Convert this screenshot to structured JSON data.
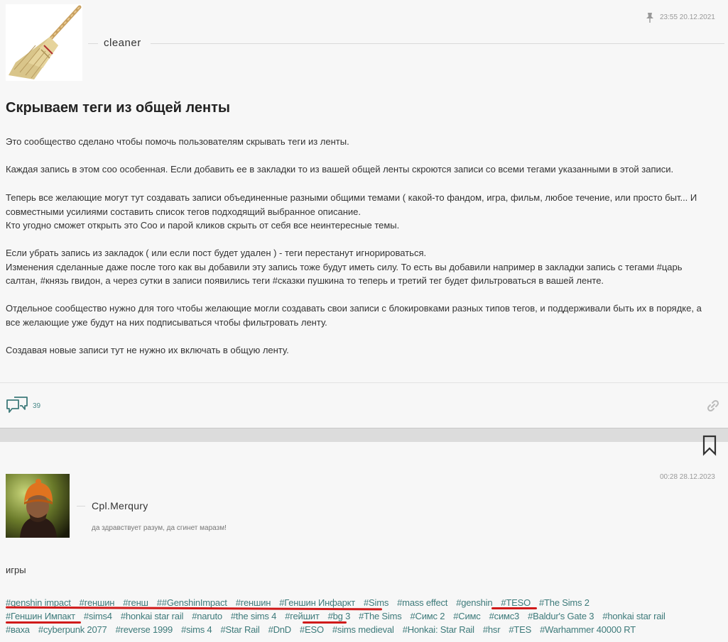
{
  "post1": {
    "author": "cleaner",
    "date": "23:55 20.12.2021",
    "title": "Скрываем теги из общей ленты",
    "paragraphs": [
      "Это сообщество сделано чтобы помочь пользователям скрывать теги из ленты.",
      "Каждая запись в этом соо особенная. Если добавить ее в закладки то из вашей общей ленты скроются записи со всеми тегами указанными в этой записи.",
      "Теперь все желающие могут тут создавать записи объединенные разными общими темами ( какой-то фандом, игра, фильм, любое течение, или просто быт... И",
      "совместными усилиями составить список тегов подходящий выбранное описание.",
      "Кто угодно сможет открыть это Соо и парой кликов скрыть от себя все неинтересные темы.",
      "Если убрать запись из закладок ( или если пост будет удален ) -  теги перестанут игнорироваться.",
      "Изменения сделанные даже после того как вы добавили эту запись тоже будут иметь силу. То есть вы добавили например в закладки запись с тегами #царь",
      "салтан, #князь гвидон, а через сутки в записи появились теги #сказки пушкина то теперь и третий тег будет фильтроваться в вашей ленте.",
      "Отдельное сообщество нужно для того чтобы желающие могли создавать свои записи с блокировками разных типов тегов, и поддерживали быть их в порядке, а",
      "все желающие уже будут на них подписываться чтобы фильтровать ленту.",
      "Создавая  новые записи тут не нужно их  включать в общую ленту."
    ],
    "comments_count": "39"
  },
  "post2": {
    "author": "Cpl.Merqury",
    "status": "да здравствует разум, да сгинет маразм!",
    "date": "00:28 28.12.2023",
    "text": "игры",
    "tag_rows": [
      [
        "#genshin impact",
        "#геншин",
        "#генш",
        "##GenshinImpact",
        "#геншин",
        "#Геншин Инфаркт",
        "#Sims",
        "#mass effect",
        "#genshin",
        "#TESO",
        "#The Sims 2"
      ],
      [
        "#Геншин Импакт",
        "#sims4",
        "#honkai star rail",
        "#naruto",
        "#the sims 4",
        "#гейшит",
        "#bg 3",
        "#The Sims",
        "#Симс 2",
        "#Симс",
        "#симс3",
        "#Baldur's Gate 3",
        "#honkai star rail"
      ],
      [
        "#ваха",
        "#cyberpunk 2077",
        "#reverse 1999",
        "#sims 4",
        "#Star Rail",
        "#DnD",
        "#ESO",
        "#sims medieval",
        "#Honkai: Star Rail",
        "#hsr",
        "#TES",
        "#Warhammer 40000 RT"
      ]
    ]
  },
  "colors": {
    "accent": "#3d7a7a",
    "underline": "#d01a1a",
    "background": "#f7f7f7"
  },
  "icons": {
    "pin": "pin-icon",
    "comments": "comments-icon",
    "link": "link-icon",
    "bookmark": "bookmark-icon"
  }
}
